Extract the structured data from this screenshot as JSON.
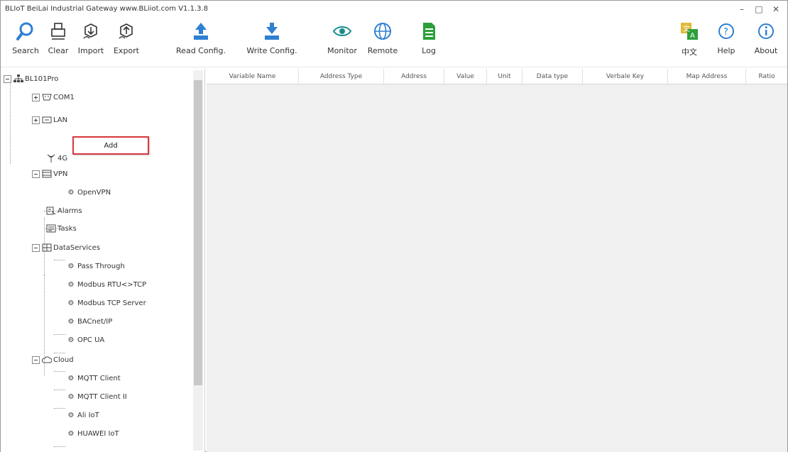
{
  "window": {
    "title": "BLIoT BeiLai Industrial Gateway www.BLiiot.com V1.1.3.8",
    "min": "–",
    "max": "□",
    "close": "✕"
  },
  "toolbar": {
    "search": "Search",
    "clear": "Clear",
    "import": "Import",
    "export": "Export",
    "read_config": "Read Config.",
    "write_config": "Write Config.",
    "monitor": "Monitor",
    "remote": "Remote",
    "log": "Log",
    "language": "中文",
    "help": "Help",
    "about": "About"
  },
  "tree": {
    "root": "BL101Pro",
    "com1": "COM1",
    "lan": "LAN",
    "ag": "4G",
    "vpn": "VPN",
    "openvpn": "OpenVPN",
    "alarms": "Alarms",
    "tasks": "Tasks",
    "dataservices": "DataServices",
    "pass_through": "Pass Through",
    "modbus_rtu_tcp": "Modbus RTU<>TCP",
    "modbus_tcp_server": "Modbus TCP Server",
    "bacnet_ip": "BACnet/IP",
    "opc_ua": "OPC UA",
    "cloud": "Cloud",
    "mqtt_client": "MQTT Client",
    "mqtt_client_ii": "MQTT Client II",
    "ali_iot": "Ali IoT",
    "huawei_iot": "HUAWEI IoT"
  },
  "context_menu": {
    "add": "Add"
  },
  "grid": {
    "columns": [
      "Variable Name",
      "Address Type",
      "Address",
      "Value",
      "Unit",
      "Data type",
      "Verbale Key",
      "Map Address",
      "Ratio"
    ]
  },
  "colors": {
    "accent": "#d9363e",
    "icon_blue": "#2f7fd2",
    "icon_green": "#2c9f3c",
    "icon_teal": "#1a8c8c"
  }
}
